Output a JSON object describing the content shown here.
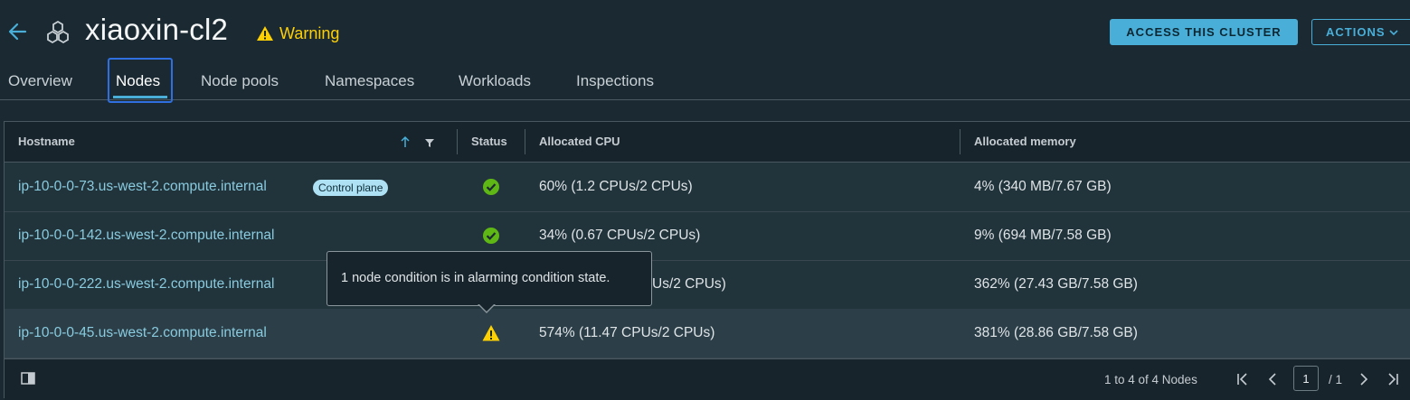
{
  "header": {
    "title": "xiaoxin-cl2",
    "status_label": "Warning",
    "access_button": "ACCESS THIS CLUSTER",
    "actions_button": "ACTIONS"
  },
  "tabs": [
    {
      "label": "Overview",
      "active": false
    },
    {
      "label": "Nodes",
      "active": true
    },
    {
      "label": "Node pools",
      "active": false
    },
    {
      "label": "Namespaces",
      "active": false
    },
    {
      "label": "Workloads",
      "active": false
    },
    {
      "label": "Inspections",
      "active": false
    }
  ],
  "table": {
    "columns": [
      "Hostname",
      "Status",
      "Allocated CPU",
      "Allocated memory"
    ],
    "sort": "ascending",
    "rows": [
      {
        "hostname": "ip-10-0-0-73.us-west-2.compute.internal",
        "badge": "Control plane",
        "status": "ok",
        "cpu": "60% (1.2 CPUs/2 CPUs)",
        "memory": "4% (340 MB/7.67 GB)"
      },
      {
        "hostname": "ip-10-0-0-142.us-west-2.compute.internal",
        "status": "ok",
        "cpu": "34% (0.67 CPUs/2 CPUs)",
        "memory": "9% (694 MB/7.58 GB)"
      },
      {
        "hostname": "ip-10-0-0-222.us-west-2.compute.internal",
        "status": "hidden",
        "cpu": "Us/2 CPUs)",
        "memory": "362% (27.43 GB/7.58 GB)"
      },
      {
        "hostname": "ip-10-0-0-45.us-west-2.compute.internal",
        "status": "warning",
        "cpu": "574% (11.47 CPUs/2 CPUs)",
        "memory": "381% (28.86 GB/7.58 GB)"
      }
    ]
  },
  "tooltip": "1 node condition is in alarming condition state.",
  "footer": {
    "range_text": "1 to 4 of 4 Nodes",
    "current_page": "1",
    "total_pages": "/ 1"
  },
  "colors": {
    "background": "#1b2a32",
    "accent": "#49afd9",
    "warning": "#fdd006",
    "success": "#5eb715",
    "link": "#89cbdf"
  }
}
